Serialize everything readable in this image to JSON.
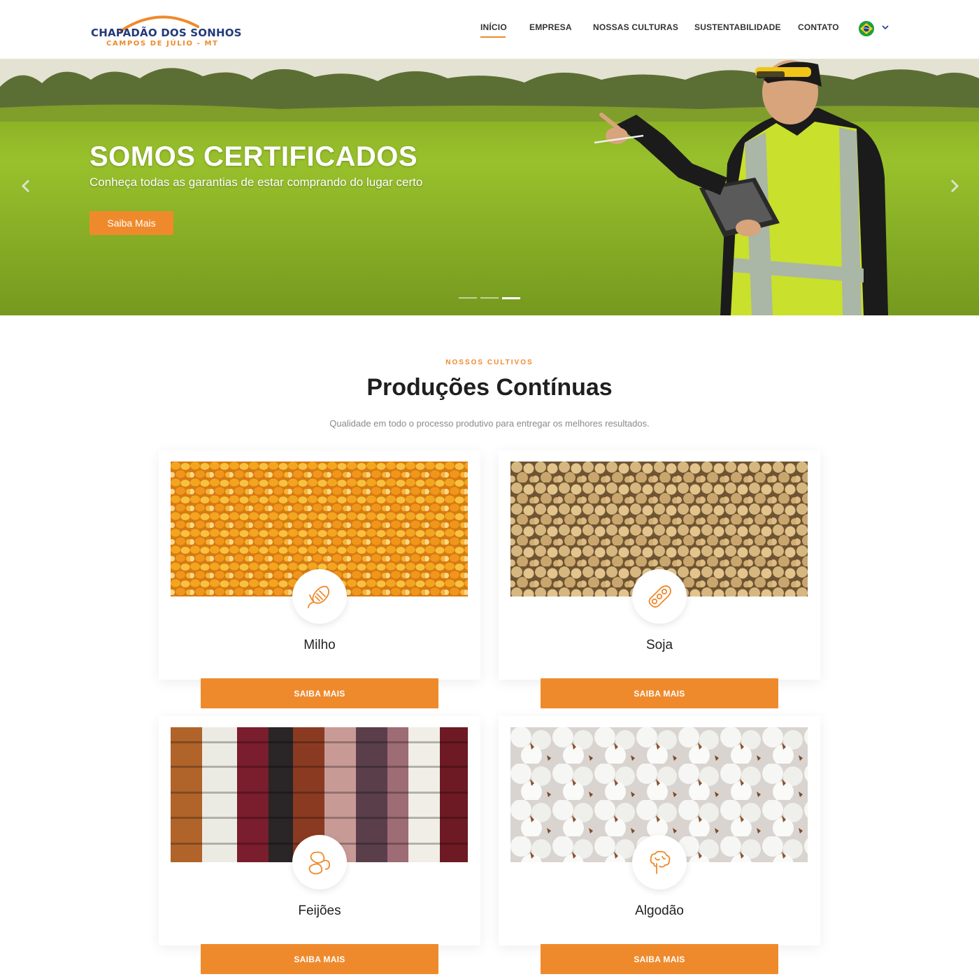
{
  "logo": {
    "name": "CHAPADÃO DOS SONHOS",
    "subtitle": "CAMPOS DE JÚLIO - MT"
  },
  "nav": {
    "items": [
      {
        "label": "INÍCIO",
        "active": true
      },
      {
        "label": "EMPRESA",
        "active": false
      },
      {
        "label": "NOSSAS CULTURAS",
        "active": false
      },
      {
        "label": "SUSTENTABILIDADE",
        "active": false
      },
      {
        "label": "CONTATO",
        "active": false
      }
    ],
    "language": {
      "icon": "brazil-flag-icon"
    }
  },
  "hero": {
    "title": "SOMOS CERTIFICADOS",
    "subtitle": "Conheça todas as garantias de estar comprando do lugar certo",
    "button_label": "Saiba Mais",
    "slides_count": 3,
    "active_slide": 3
  },
  "section": {
    "eyebrow": "NOSSOS CULTIVOS",
    "title": "Produções Contínuas",
    "description": "Qualidade em todo o processo produtivo para entregar os melhores resultados."
  },
  "cards": [
    {
      "title": "Milho",
      "button_label": "SAIBA MAIS",
      "icon": "corn-icon"
    },
    {
      "title": "Soja",
      "button_label": "SAIBA MAIS",
      "icon": "soybean-icon"
    },
    {
      "title": "Feijões",
      "button_label": "SAIBA MAIS",
      "icon": "beans-icon"
    },
    {
      "title": "Algodão",
      "button_label": "SAIBA MAIS",
      "icon": "cotton-icon"
    }
  ],
  "colors": {
    "accent": "#ef8a2c",
    "logo_blue": "#233a7a",
    "text_dark": "#1f1f1f",
    "muted": "#8a8a8a"
  }
}
